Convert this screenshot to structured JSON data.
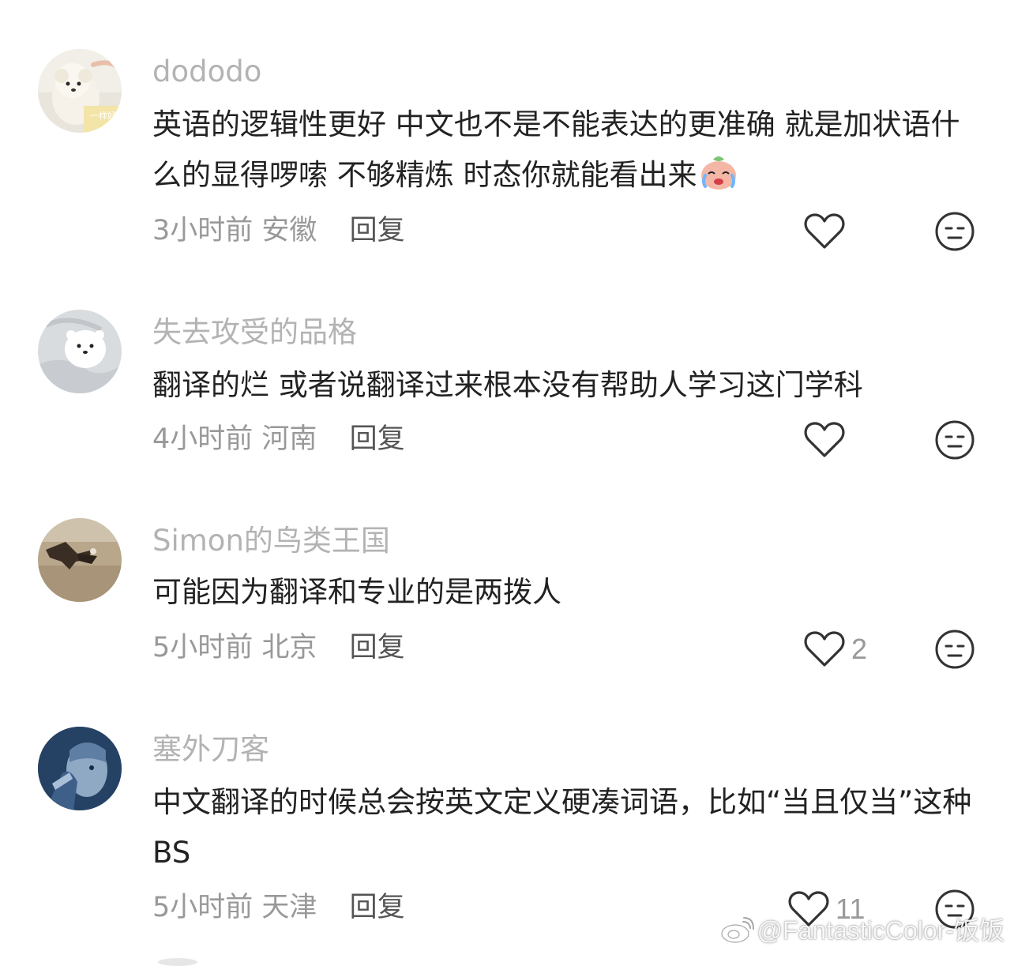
{
  "comments": [
    {
      "username": "dododo",
      "text": "英语的逻辑性更好 中文也不是不能表达的更准确 就是加状语什么的显得啰嗦 不够精炼 时态你就能看出来",
      "time": "3小时前",
      "location": "安徽",
      "reply": "回复",
      "likes": "",
      "avatar_text": "一样好"
    },
    {
      "username": "失去攻受的品格",
      "text": "翻译的烂 或者说翻译过来根本没有帮助人学习这门学科",
      "time": "4小时前",
      "location": "河南",
      "reply": "回复",
      "likes": ""
    },
    {
      "username": "Simon的鸟类王国",
      "text": "可能因为翻译和专业的是两拨人",
      "time": "5小时前",
      "location": "北京",
      "reply": "回复",
      "likes": "2"
    },
    {
      "username": "塞外刀客",
      "text": "中文翻译的时候总会按英文定义硬凑词语，比如“当且仅当”这种BS",
      "time": "5小时前",
      "location": "天津",
      "reply": "回复",
      "likes": "11"
    }
  ],
  "watermark": "@FantasticColor-饭饭",
  "icons": {
    "like": "heart-outline-icon",
    "dislike": "meh-face-icon",
    "emoji": "crying-peach-emoji-icon",
    "watermark": "weibo-logo-icon"
  },
  "colors": {
    "username": "#b3b3b3",
    "text": "#222222",
    "meta": "#999999",
    "icon": "#333333"
  }
}
